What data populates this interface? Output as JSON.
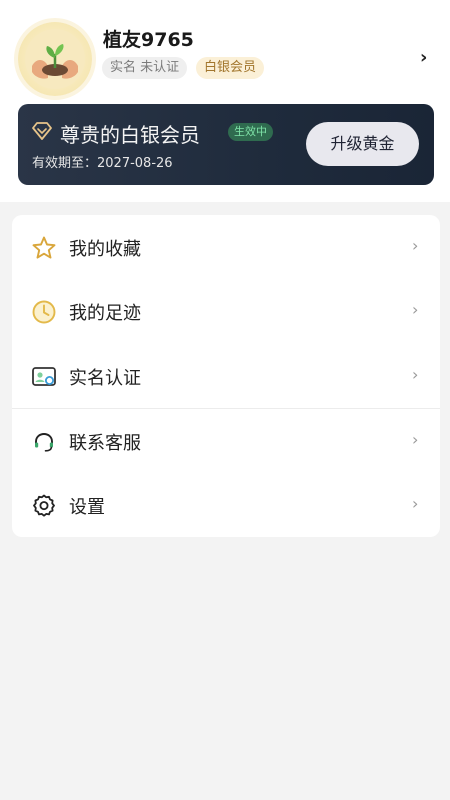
{
  "profile": {
    "username": "植友9765",
    "verify_tag": "实名 未认证",
    "member_tag": "白银会员",
    "arrow": "›"
  },
  "membership": {
    "title": "尊贵的白银会员",
    "status": "生效中",
    "expiry_label": "有效期至：2027-08-26",
    "upgrade_label": "升级黄金",
    "colors": {
      "card": "#1f2b3c",
      "status_bg": "#2f6b4f",
      "status_text": "#7fe3a8"
    }
  },
  "menu": {
    "chevron": "›",
    "items": [
      {
        "label": "我的收藏",
        "icon": "star-icon"
      },
      {
        "label": "我的足迹",
        "icon": "clock-icon"
      },
      {
        "label": "实名认证",
        "icon": "id-card-icon"
      },
      {
        "label": "联系客服",
        "icon": "headset-icon"
      },
      {
        "label": "设置",
        "icon": "gear-icon"
      }
    ]
  }
}
